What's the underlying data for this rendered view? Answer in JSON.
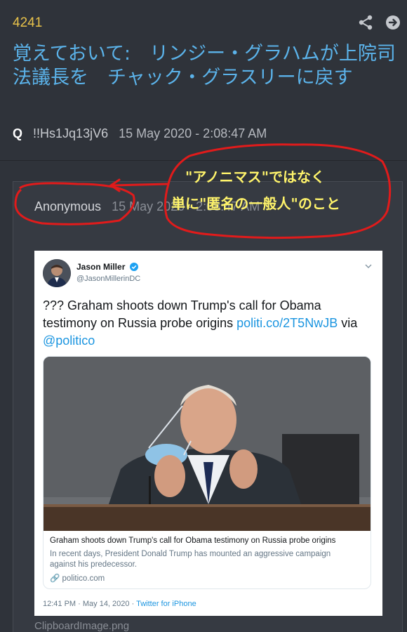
{
  "post": {
    "number": "4241",
    "title": "覚えておいて:　リンジー・グラハムが上院司法議長を　チャック・グラスリーに戻す",
    "author": "Q",
    "tripcode": "!!Hs1Jq13jV6",
    "date": "15 May 2020 - 2:08:47 AM",
    "icons": [
      "share-icon",
      "arrow-right-circle-icon"
    ]
  },
  "reply": {
    "author": "Anonymous",
    "date": "15 May 2020 - 2:08:47 AM",
    "filename": "ClipboardImage.png"
  },
  "tweet": {
    "name": "Jason Miller",
    "handle": "@JasonMillerinDC",
    "text_prefix": "??? Graham shoots down Trump's call for Obama testimony on Russia probe origins ",
    "text_link": "politi.co/2T5NwJB",
    "text_via": " via ",
    "text_mention": "@politico",
    "card_title": "Graham shoots down Trump's call for Obama testimony on Russia probe origins",
    "card_description": "In recent days, President Donald Trump has mounted an aggressive campaign against his predecessor.",
    "card_domain": "politico.com",
    "timestamp": "12:41 PM · May 14, 2020 · ",
    "source": "Twitter for iPhone"
  },
  "annotation": {
    "line1": "\"アノニマス\"ではなく",
    "line2": "単に\"匿名の一般人\"のこと",
    "color": "#e11b1b",
    "text_color": "#fff46b"
  },
  "colors": {
    "background": "#2f333a",
    "title": "#5bb3ea",
    "post_number": "#e8c24a",
    "link": "#1b95e0"
  }
}
